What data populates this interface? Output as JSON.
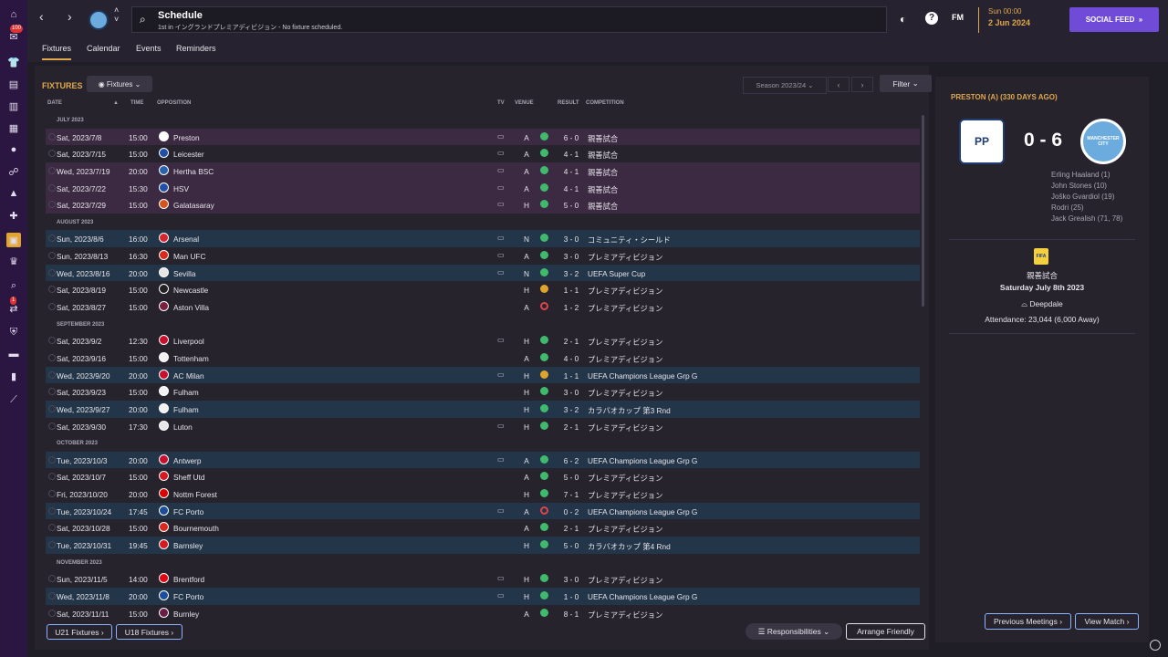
{
  "sidebar": {
    "badge_1": "100",
    "badge_2": "1"
  },
  "header": {
    "title": "Schedule",
    "subtitle": "1st in イングランドプレミアディビジョン - No fixture scheduled.",
    "fm_label": "FM",
    "date_time": "Sun 00:00",
    "date_day": "2 Jun 2024",
    "social_feed": "SOCIAL FEED"
  },
  "subtabs": [
    "Fixtures",
    "Calendar",
    "Events",
    "Reminders"
  ],
  "fixtures": {
    "heading": "FIXTURES",
    "dropdown": "Fixtures",
    "season": "Season 2023/24",
    "filter": "Filter",
    "columns": {
      "date": "DATE",
      "time": "TIME",
      "opposition": "OPPOSITION",
      "tv": "TV",
      "venue": "VENUE",
      "result": "RESULT",
      "competition": "COMPETITION"
    },
    "rows": [
      {
        "kind": "month",
        "label": "JULY 2023"
      },
      {
        "kind": "match",
        "style": "pink",
        "date": "Sat, 2023/7/8",
        "time": "15:00",
        "opp": "Preston",
        "crest": "#ffffff",
        "tv": true,
        "venue": "A",
        "result": "win",
        "score": "6 - 0",
        "comp": "親善試合"
      },
      {
        "kind": "match",
        "style": "",
        "date": "Sat, 2023/7/15",
        "time": "15:00",
        "opp": "Leicester",
        "crest": "#1f4fa8",
        "tv": true,
        "venue": "A",
        "result": "win",
        "score": "4 - 1",
        "comp": "親善試合"
      },
      {
        "kind": "match",
        "style": "pink",
        "date": "Wed, 2023/7/19",
        "time": "20:00",
        "opp": "Hertha BSC",
        "crest": "#2a62b0",
        "tv": true,
        "venue": "A",
        "result": "win",
        "score": "4 - 1",
        "comp": "親善試合"
      },
      {
        "kind": "match",
        "style": "pink",
        "date": "Sat, 2023/7/22",
        "time": "15:30",
        "opp": "HSV",
        "crest": "#1f4fa8",
        "tv": true,
        "venue": "A",
        "result": "win",
        "score": "4 - 1",
        "comp": "親善試合"
      },
      {
        "kind": "match",
        "style": "pink",
        "date": "Sat, 2023/7/29",
        "time": "15:00",
        "opp": "Galatasaray",
        "crest": "#d4541c",
        "tv": true,
        "venue": "H",
        "result": "win",
        "score": "5 - 0",
        "comp": "親善試合"
      },
      {
        "kind": "month",
        "label": "AUGUST 2023"
      },
      {
        "kind": "match",
        "style": "blue",
        "date": "Sun, 2023/8/6",
        "time": "16:00",
        "opp": "Arsenal",
        "crest": "#d7262d",
        "tv": true,
        "venue": "N",
        "result": "win",
        "score": "3 - 0",
        "comp": "コミュニティ・シールド"
      },
      {
        "kind": "match",
        "style": "",
        "date": "Sun, 2023/8/13",
        "time": "16:30",
        "opp": "Man UFC",
        "crest": "#da291c",
        "tv": true,
        "venue": "A",
        "result": "win",
        "score": "3 - 0",
        "comp": "プレミアディビジョン"
      },
      {
        "kind": "match",
        "style": "blue",
        "date": "Wed, 2023/8/16",
        "time": "20:00",
        "opp": "Sevilla",
        "crest": "#e5e5e5",
        "tv": true,
        "venue": "N",
        "result": "win",
        "score": "3 - 2",
        "comp": "UEFA Super Cup"
      },
      {
        "kind": "match",
        "style": "",
        "date": "Sat, 2023/8/19",
        "time": "15:00",
        "opp": "Newcastle",
        "crest": "#222222",
        "tv": false,
        "venue": "H",
        "result": "draw",
        "score": "1 - 1",
        "comp": "プレミアディビジョン"
      },
      {
        "kind": "match",
        "style": "",
        "date": "Sat, 2023/8/27",
        "time": "15:00",
        "opp": "Aston Villa",
        "crest": "#7b1f3f",
        "tv": false,
        "venue": "A",
        "result": "loss",
        "score": "1 - 2",
        "comp": "プレミアディビジョン"
      },
      {
        "kind": "month",
        "label": "SEPTEMBER 2023"
      },
      {
        "kind": "match",
        "style": "",
        "date": "Sat, 2023/9/2",
        "time": "12:30",
        "opp": "Liverpool",
        "crest": "#c8102e",
        "tv": true,
        "venue": "H",
        "result": "win",
        "score": "2 - 1",
        "comp": "プレミアディビジョン"
      },
      {
        "kind": "match",
        "style": "",
        "date": "Sat, 2023/9/16",
        "time": "15:00",
        "opp": "Tottenham",
        "crest": "#f2f2f2",
        "tv": false,
        "venue": "A",
        "result": "win",
        "score": "4 - 0",
        "comp": "プレミアディビジョン"
      },
      {
        "kind": "match",
        "style": "blue",
        "date": "Wed, 2023/9/20",
        "time": "20:00",
        "opp": "AC Milan",
        "crest": "#c8102e",
        "tv": true,
        "venue": "H",
        "result": "draw",
        "score": "1 - 1",
        "comp": "UEFA Champions League Grp G"
      },
      {
        "kind": "match",
        "style": "",
        "date": "Sat, 2023/9/23",
        "time": "15:00",
        "opp": "Fulham",
        "crest": "#f2f2f2",
        "tv": false,
        "venue": "H",
        "result": "win",
        "score": "3 - 0",
        "comp": "プレミアディビジョン"
      },
      {
        "kind": "match",
        "style": "blue",
        "date": "Wed, 2023/9/27",
        "time": "20:00",
        "opp": "Fulham",
        "crest": "#f2f2f2",
        "tv": false,
        "venue": "H",
        "result": "win",
        "score": "3 - 2",
        "comp": "カラバオカップ 第3 Rnd"
      },
      {
        "kind": "match",
        "style": "",
        "date": "Sat, 2023/9/30",
        "time": "17:30",
        "opp": "Luton",
        "crest": "#e8e8e8",
        "tv": true,
        "venue": "H",
        "result": "win",
        "score": "2 - 1",
        "comp": "プレミアディビジョン"
      },
      {
        "kind": "month",
        "label": "OCTOBER 2023"
      },
      {
        "kind": "match",
        "style": "blue",
        "date": "Tue, 2023/10/3",
        "time": "20:00",
        "opp": "Antwerp",
        "crest": "#c8102e",
        "tv": true,
        "venue": "A",
        "result": "win",
        "score": "6 - 2",
        "comp": "UEFA Champions League Grp G"
      },
      {
        "kind": "match",
        "style": "",
        "date": "Sat, 2023/10/7",
        "time": "15:00",
        "opp": "Sheff Utd",
        "crest": "#d71920",
        "tv": false,
        "venue": "A",
        "result": "win",
        "score": "5 - 0",
        "comp": "プレミアディビジョン"
      },
      {
        "kind": "match",
        "style": "",
        "date": "Fri, 2023/10/20",
        "time": "20:00",
        "opp": "Nottm Forest",
        "crest": "#dd0000",
        "tv": false,
        "venue": "H",
        "result": "win",
        "score": "7 - 1",
        "comp": "プレミアディビジョン"
      },
      {
        "kind": "match",
        "style": "blue",
        "date": "Tue, 2023/10/24",
        "time": "17:45",
        "opp": "FC Porto",
        "crest": "#1c4c9c",
        "tv": true,
        "venue": "A",
        "result": "loss",
        "score": "0 - 2",
        "comp": "UEFA Champions League Grp G"
      },
      {
        "kind": "match",
        "style": "",
        "date": "Sat, 2023/10/28",
        "time": "15:00",
        "opp": "Bournemouth",
        "crest": "#da291c",
        "tv": false,
        "venue": "A",
        "result": "win",
        "score": "2 - 1",
        "comp": "プレミアディビジョン"
      },
      {
        "kind": "match",
        "style": "blue",
        "date": "Tue, 2023/10/31",
        "time": "19:45",
        "opp": "Barnsley",
        "crest": "#d71920",
        "tv": false,
        "venue": "H",
        "result": "win",
        "score": "5 - 0",
        "comp": "カラバオカップ 第4 Rnd"
      },
      {
        "kind": "month",
        "label": "NOVEMBER 2023"
      },
      {
        "kind": "match",
        "style": "",
        "date": "Sun, 2023/11/5",
        "time": "14:00",
        "opp": "Brentford",
        "crest": "#e30613",
        "tv": true,
        "venue": "H",
        "result": "win",
        "score": "3 - 0",
        "comp": "プレミアディビジョン"
      },
      {
        "kind": "match",
        "style": "blue",
        "date": "Wed, 2023/11/8",
        "time": "20:00",
        "opp": "FC Porto",
        "crest": "#1c4c9c",
        "tv": true,
        "venue": "H",
        "result": "win",
        "score": "1 - 0",
        "comp": "UEFA Champions League Grp G"
      },
      {
        "kind": "match",
        "style": "",
        "date": "Sat, 2023/11/11",
        "time": "15:00",
        "opp": "Burnley",
        "crest": "#6c1d45",
        "tv": false,
        "venue": "A",
        "result": "win",
        "score": "8 - 1",
        "comp": "プレミアディビジョン"
      }
    ],
    "u21_button": "U21 Fixtures",
    "u18_button": "U18 Fixtures",
    "responsibilities": "Responsibilities",
    "arrange_friendly": "Arrange Friendly"
  },
  "detail": {
    "title": "PRESTON (A) (330 DAYS AGO)",
    "home_crest_text": "PP",
    "away_crest_text": "MANCHESTER CITY",
    "score": "0 - 6",
    "scorers": [
      "Erling Haaland (1)",
      "John Stones (10)",
      "Joško Gvardiol (19)",
      "Rodri (25)",
      "Jack Grealish (71, 78)"
    ],
    "competition": "親善試合",
    "date": "Saturday July 8th 2023",
    "stadium": "Deepdale",
    "attendance": "Attendance: 23,044 (6,000 Away)",
    "previous_meetings": "Previous Meetings",
    "view_match": "View Match"
  },
  "colors": {
    "accent": "#e0a84a",
    "social": "#6f4bd7",
    "win": "#3fba6c",
    "draw": "#e0a32c",
    "loss": "#e0434b"
  }
}
